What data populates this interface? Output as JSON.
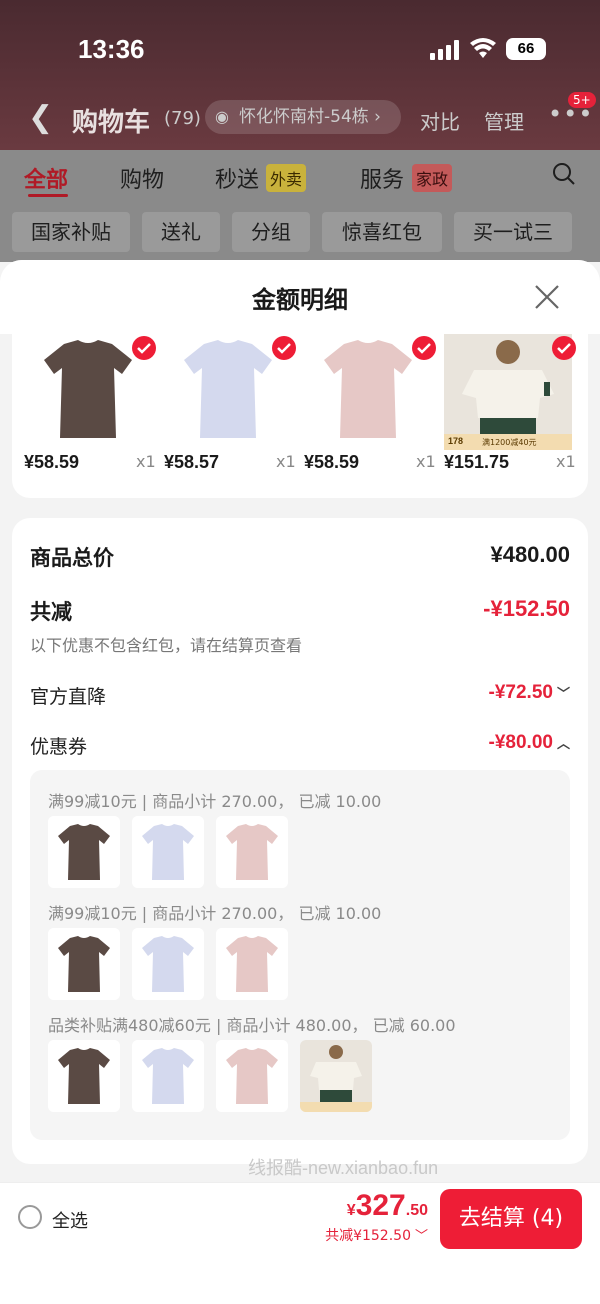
{
  "status_bar": {
    "time": "13:36",
    "battery": "66"
  },
  "nav": {
    "title": "购物车",
    "count": "(79)",
    "address": "怀化怀南村-54栋",
    "compare": "对比",
    "manage": "管理",
    "more_badge": "5+"
  },
  "tabs": {
    "all": "全部",
    "shopping": "购物",
    "express": "秒送",
    "express_tag": "外卖",
    "service": "服务",
    "service_tag": "家政"
  },
  "chips": [
    "国家补贴",
    "送礼",
    "分组",
    "惊喜红包",
    "买一试三"
  ],
  "sheet": {
    "title": "金额明细",
    "products": [
      {
        "price": "¥58.59",
        "qty": "x1",
        "color": "#5a4a44"
      },
      {
        "price": "¥58.57",
        "qty": "x1",
        "color": "#d4d9ee"
      },
      {
        "price": "¥58.59",
        "qty": "x1",
        "color": "#e6c8c6"
      },
      {
        "price": "¥151.75",
        "qty": "x1",
        "color": "#f1ede4"
      }
    ],
    "photo_badge": {
      "price": "178",
      "promo": "满1200减40元"
    },
    "summary": {
      "goods_total_label": "商品总价",
      "goods_total_value": "¥480.00",
      "discount_label": "共减",
      "discount_value": "-¥152.50",
      "hint": "以下优惠不包含红包，请在结算页查看",
      "official_label": "官方直降",
      "official_value": "-¥72.50",
      "coupon_label": "优惠券",
      "coupon_value": "-¥80.00"
    },
    "coupon_groups": [
      {
        "text": "满99减10元 | 商品小计 270.00， 已减 10.00"
      },
      {
        "text": "满99减10元 | 商品小计 270.00， 已减 10.00"
      },
      {
        "text": "品类补贴满480减60元 | 商品小计 480.00， 已减 60.00"
      }
    ]
  },
  "watermark": "线报酷-new.xianbao.fun",
  "bottom": {
    "select_all": "全选",
    "total_symbol": "¥",
    "total_int": "327",
    "total_dec": ".50",
    "saved": "共减¥152.50",
    "checkout": "去结算 (4)"
  },
  "colors": {
    "accent": "#ee1d36",
    "price_red": "#e5223a"
  }
}
